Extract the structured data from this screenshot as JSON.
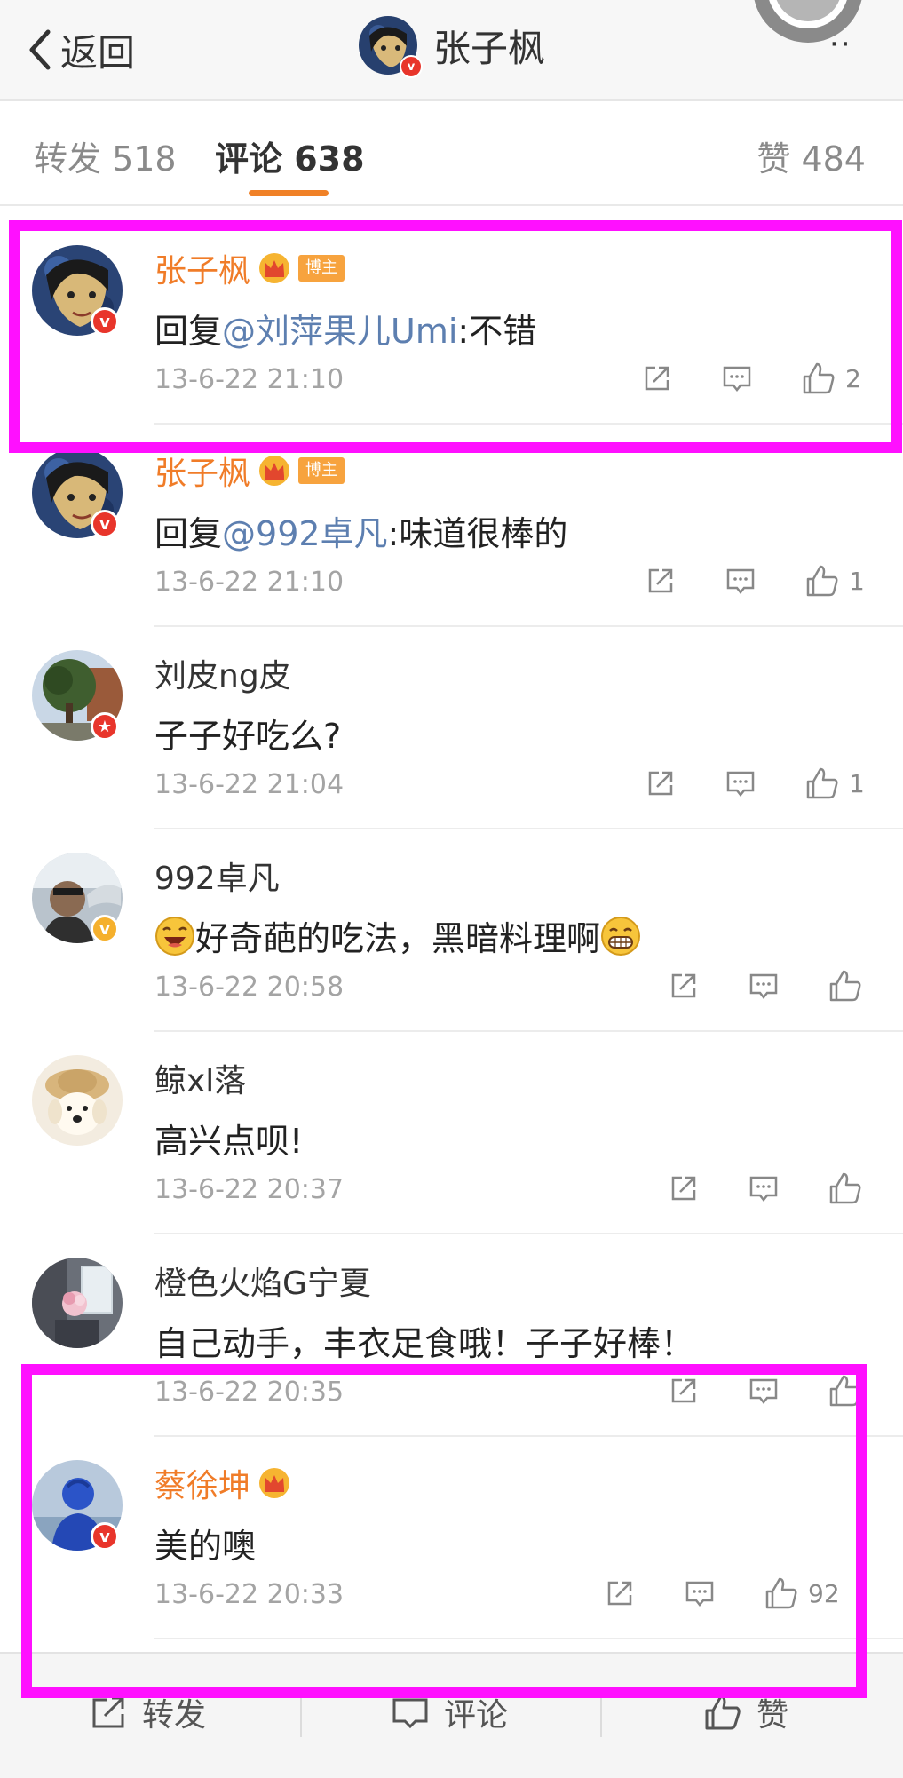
{
  "nav": {
    "back_label": "返回",
    "title": "张子枫",
    "verified_mark": "v",
    "more_icon": "more-dots-icon"
  },
  "tabs": {
    "repost": "转发 518",
    "comment": "评论 638",
    "like": "赞 484",
    "active": "comment"
  },
  "comments": [
    {
      "name": "张子枫",
      "vip": true,
      "crown": true,
      "tag": "博主",
      "badge": "red",
      "badge_text": "v",
      "text_prefix": "回复",
      "mention": "@刘萍果儿Umi",
      "text_suffix": ":不错",
      "time": "13-6-22 21:10",
      "likes": "2"
    },
    {
      "name": "张子枫",
      "vip": true,
      "crown": true,
      "tag": "博主",
      "badge": "red",
      "badge_text": "v",
      "text_prefix": "回复",
      "mention": "@992卓凡",
      "text_suffix": ":味道很棒的",
      "time": "13-6-22 21:10",
      "likes": "1"
    },
    {
      "name": "刘皮ng皮",
      "vip": false,
      "badge": "red",
      "badge_text": "★",
      "text": "子子好吃么?",
      "time": "13-6-22 21:04",
      "likes": "1"
    },
    {
      "name": "992卓凡",
      "vip": false,
      "badge": "gold",
      "badge_text": "v",
      "text": "好奇葩的吃法，黑暗料理啊",
      "emoji_left": "laughing-emoji",
      "emoji_right": "grinning-emoji",
      "time": "13-6-22 20:58",
      "likes": ""
    },
    {
      "name": "鲸xl落",
      "vip": false,
      "text": "高兴点呗!",
      "time": "13-6-22 20:37",
      "likes": ""
    },
    {
      "name": "橙色火焰G宁夏",
      "vip": false,
      "text": "自己动手，丰衣足食哦！子子好棒！",
      "time": "13-6-22 20:35",
      "likes": ""
    },
    {
      "name": "蔡徐坤",
      "vip": true,
      "crown": true,
      "badge": "red",
      "badge_text": "v",
      "text": "美的噢",
      "time": "13-6-22 20:33",
      "likes": "92"
    }
  ],
  "bottombar": {
    "repost": "转发",
    "comment": "评论",
    "like": "赞"
  },
  "colors": {
    "highlight": "#ff10ff",
    "vip_name": "#f07c28",
    "mention": "#5d7fb0",
    "tab_underline": "#f08127"
  }
}
